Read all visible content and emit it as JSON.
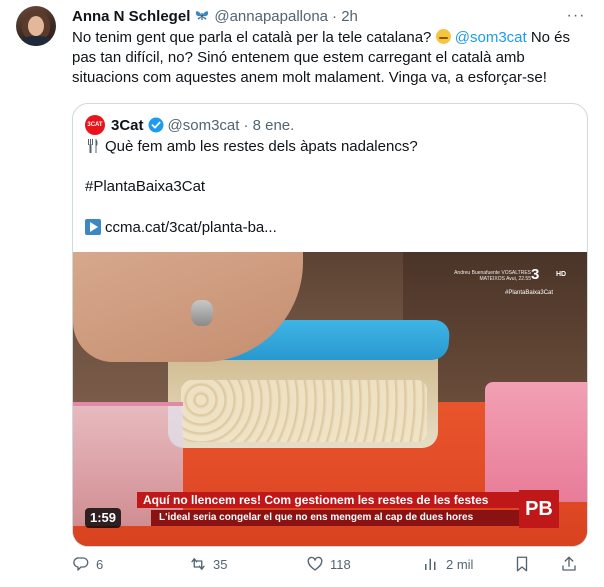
{
  "tweet": {
    "author_name": "Anna N Schlegel",
    "author_handle": "@annapapallona",
    "time": "· 2h",
    "more_label": "···",
    "text_1": "No tenim gent que parla el català per la tele catalana?",
    "mention": "@som3cat",
    "text_2": " No és pas tan difícil, no? Sinó entenem que estem carregant el català amb situacions com aquestes anem molt malament. Vinga va, a esforçar-se!"
  },
  "quote": {
    "avatar_text": "3CAT",
    "name": "3Cat",
    "handle": "@som3cat",
    "time": "· 8 ene.",
    "line1": "Què fem amb les restes dels àpats nadalencs?",
    "hashtag": "#PlantaBaixa3Cat",
    "link": "ccma.cat/3cat/planta-ba...",
    "media": {
      "watermark_lines": "Andreu Buenafuente VOSALTRES MATEIXOS Avui, 22.55",
      "watermark_logo": "3",
      "watermark_hd": "HD",
      "watermark_tag": "#PlantaBaixa3Cat",
      "banner_main": "Aquí no llencem res! Com gestionem les restes de les festes",
      "banner_sub": "L'ideal seria congelar el que no ens mengem al cap de dues hores",
      "pb": "PB",
      "duration": "1:59"
    }
  },
  "actions": {
    "replies": "6",
    "retweets": "35",
    "likes": "118",
    "views": "2 mil"
  },
  "colors": {
    "link": "#1d9bf0",
    "secondary_text": "#536471",
    "verified": "#1d9bf0",
    "brand_3cat": "#e8141c"
  }
}
